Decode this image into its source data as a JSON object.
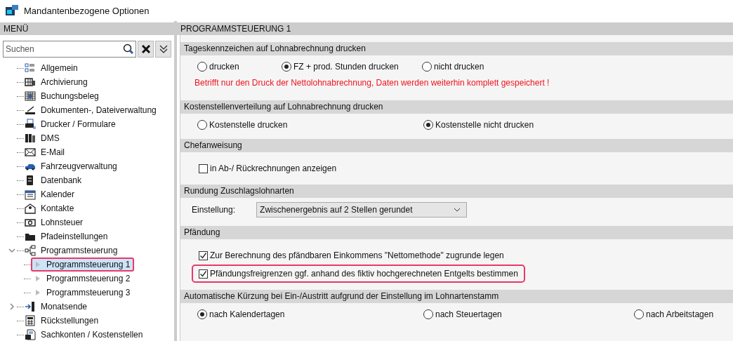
{
  "window": {
    "title": "Mandantenbezogene Optionen"
  },
  "sidebar": {
    "header": "MENÜ",
    "search": {
      "placeholder": "Suchen"
    },
    "items": [
      {
        "label": "Allgemein",
        "selected": false
      },
      {
        "label": "Archivierung",
        "selected": false
      },
      {
        "label": "Buchungsbeleg",
        "selected": false
      },
      {
        "label": "Dokumenten-, Dateiverwaltung",
        "selected": false
      },
      {
        "label": "Drucker / Formulare",
        "selected": false
      },
      {
        "label": "DMS",
        "selected": false
      },
      {
        "label": "E-Mail",
        "selected": false
      },
      {
        "label": "Fahrzeugverwaltung",
        "selected": false
      },
      {
        "label": "Datenbank",
        "selected": false
      },
      {
        "label": "Kalender",
        "selected": false
      },
      {
        "label": "Kontakte",
        "selected": false
      },
      {
        "label": "Lohnsteuer",
        "selected": false
      },
      {
        "label": "Pfadeinstellungen",
        "selected": false
      },
      {
        "label": "Programmsteuerung",
        "selected": false,
        "expanded": true,
        "children": [
          {
            "label": "Programmsteuerung 1",
            "selected": true,
            "highlighted": true
          },
          {
            "label": "Programmsteuerung 2",
            "selected": false,
            "highlighted": false
          },
          {
            "label": "Programmsteuerung 3",
            "selected": false,
            "highlighted": false
          }
        ]
      },
      {
        "label": "Monatsende",
        "selected": false,
        "expanded": false
      },
      {
        "label": "Rückstellungen",
        "selected": false
      },
      {
        "label": "Sachkonten / Kostenstellen",
        "selected": false
      }
    ]
  },
  "content": {
    "header": "PROGRAMMSTEUERUNG 1",
    "sections": [
      {
        "title": "Tageskennzeichen auf Lohnabrechnung drucken",
        "kind": "radios",
        "options": [
          {
            "label": "drucken",
            "selected": false
          },
          {
            "label": "FZ + prod. Stunden drucken",
            "selected": true
          },
          {
            "label": "nicht drucken",
            "selected": false
          }
        ],
        "note": "Betrifft nur den Druck der Nettolohnabrechnung, Daten werden weiterhin komplett gespeichert !"
      },
      {
        "title": "Kostenstellenverteilung auf Lohnabrechnung drucken",
        "kind": "radios",
        "options": [
          {
            "label": "Kostenstelle drucken",
            "selected": false
          },
          {
            "label": "Kostenstelle nicht drucken",
            "selected": true
          }
        ]
      },
      {
        "title": "Chefanweisung",
        "kind": "checks",
        "options": [
          {
            "label": "in Ab-/ Rückrechnungen anzeigen",
            "checked": false,
            "highlighted": false
          }
        ]
      },
      {
        "title": "Rundung Zuschlagslohnarten",
        "kind": "select",
        "label": "Einstellung:",
        "value": "Zwischenergebnis auf 2 Stellen gerundet"
      },
      {
        "title": "Pfändung",
        "kind": "checks",
        "options": [
          {
            "label": "Zur Berechnung des pfändbaren Einkommens \"Nettomethode\" zugrunde legen",
            "checked": true,
            "highlighted": false
          },
          {
            "label": "Pfändungsfreigrenzen ggf. anhand des fiktiv hochgerechneten Entgelts bestimmen",
            "checked": true,
            "highlighted": true
          }
        ]
      },
      {
        "title": "Automatische Kürzung bei Ein-/Austritt aufgrund der Einstellung im Lohnartenstamm",
        "kind": "radios",
        "options": [
          {
            "label": "nach Kalendertagen",
            "selected": true
          },
          {
            "label": "nach Steuertagen",
            "selected": false
          },
          {
            "label": "nach Arbeitstagen",
            "selected": false
          }
        ]
      }
    ]
  }
}
